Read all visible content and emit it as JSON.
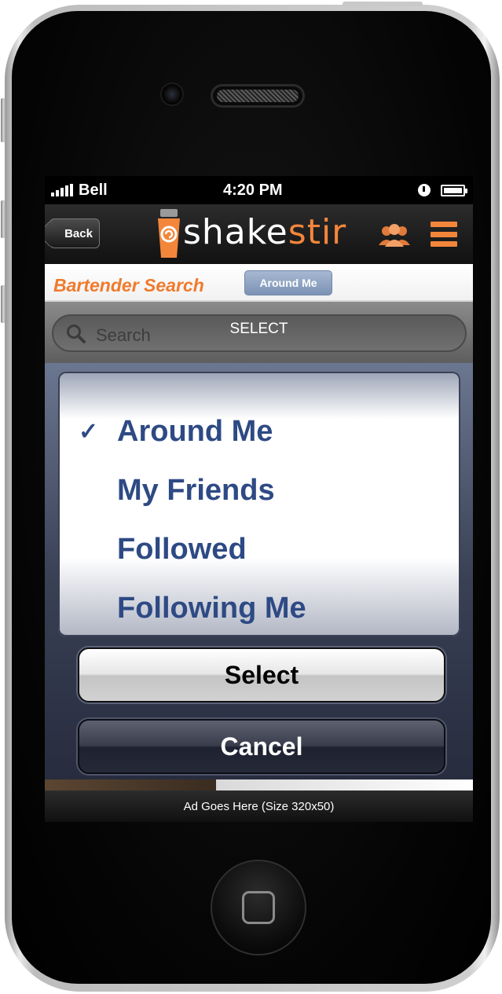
{
  "status_bar": {
    "carrier": "Bell",
    "time": "4:20 PM"
  },
  "nav": {
    "back_label": "Back",
    "logo_part1": "shake",
    "logo_part2": "stir",
    "accent_color": "#f3863b"
  },
  "sub_header": {
    "title": "Bartender Search",
    "filter_label": "Around Me"
  },
  "search": {
    "placeholder": "Search",
    "overlay_title": "SELECT"
  },
  "picker": {
    "selected_index": 0,
    "options": [
      {
        "label": "Around Me"
      },
      {
        "label": "My Friends"
      },
      {
        "label": "Followed"
      },
      {
        "label": "Following Me"
      }
    ],
    "text_color": "#2e4a84"
  },
  "actions": {
    "select_label": "Select",
    "cancel_label": "Cancel"
  },
  "ad": {
    "text": "Ad Goes Here (Size 320x50)"
  },
  "icons": [
    "signal-icon",
    "alarm-icon",
    "battery-icon",
    "back-icon",
    "friends-icon",
    "menu-icon",
    "search-icon",
    "check-icon",
    "home-icon"
  ]
}
